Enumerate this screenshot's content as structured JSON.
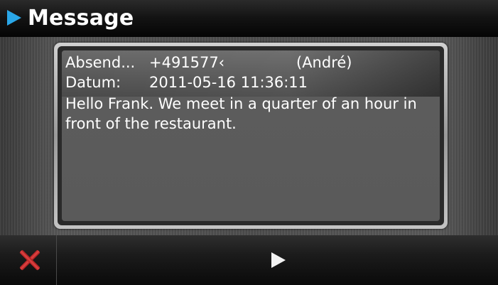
{
  "window": {
    "title": "Message",
    "title_icon": "play-triangle-icon",
    "accent_color": "#2aa7e8"
  },
  "message": {
    "sender_label": "Absend...",
    "sender_number": "+491577‹",
    "sender_name": "(André)",
    "date_label": "Datum:",
    "date_value": "2011-05-16 11:36:11",
    "body": "Hello Frank. We meet in a quarter of an hour in front of the restaurant."
  },
  "toolbar": {
    "close_icon": "close-x-icon",
    "close_color": "#d83232",
    "next_icon": "play-triangle-icon"
  }
}
